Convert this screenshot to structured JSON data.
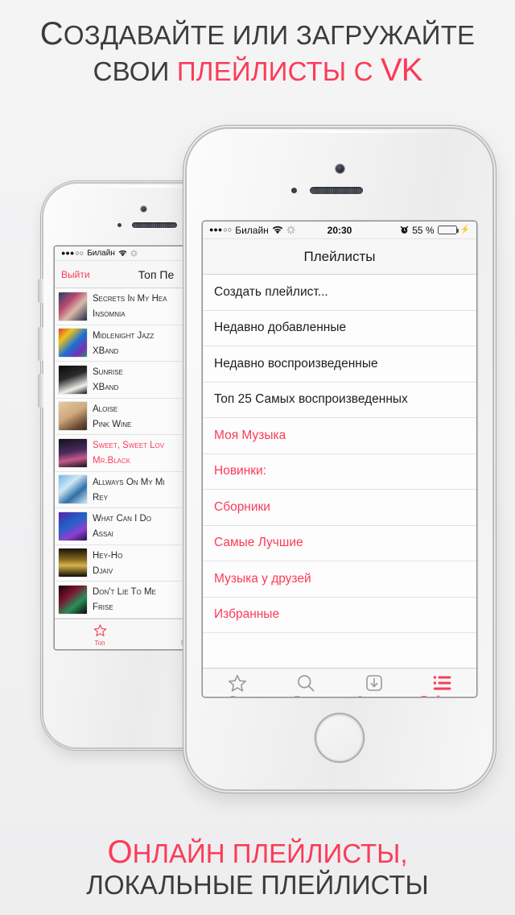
{
  "promo": {
    "headline_line1_lead": "С",
    "headline_line1_rest": "ОЗДАВАЙТЕ ИЛИ ЗАГРУЖАЙТЕ",
    "headline_line2_plain": "СВОИ ",
    "headline_line2_accent": "ПЛЕЙЛИСТЫ С ",
    "headline_line2_brand": "VK",
    "footline_lead": "О",
    "footline_accent_rest": "НЛАЙН ПЛЕЙЛИСТЫ,",
    "footline_line2": "ЛОКАЛЬНЫЕ ПЛЕЙЛИСТЫ",
    "accent_color": "#fb3b58",
    "text_color": "#3c3c3e",
    "background_color": "#f2f2f3"
  },
  "front_phone": {
    "status_bar": {
      "signal_dots_filled": "●●●",
      "signal_dots_empty": "○○",
      "carrier": "Билайн",
      "wifi_icon": "wifi-icon",
      "activity_icon": "spinner-icon",
      "time": "20:30",
      "alarm_icon": "alarm-clock-icon",
      "battery_percent": "55 %",
      "battery_level": 55,
      "battery_color": "#4cd551",
      "charging_icon": "bolt-icon"
    },
    "nav": {
      "title": "Плейлисты"
    },
    "rows": [
      {
        "label": "Создать плейлист...",
        "accent": false
      },
      {
        "label": "Недавно добавленные",
        "accent": false
      },
      {
        "label": "Недавно воспроизведенные",
        "accent": false
      },
      {
        "label": "Топ 25 Самых воспроизведенных",
        "accent": false
      },
      {
        "label": "Моя Музыка",
        "accent": true
      },
      {
        "label": "Новинки:",
        "accent": true
      },
      {
        "label": "Сборники",
        "accent": true
      },
      {
        "label": "Самые Лучшие",
        "accent": true
      },
      {
        "label": "Музыка у друзей",
        "accent": true
      },
      {
        "label": "Избранные",
        "accent": true
      }
    ],
    "tabs": [
      {
        "label": "Топ",
        "icon": "star-icon",
        "active": false
      },
      {
        "label": "Поиск",
        "icon": "search-icon",
        "active": false
      },
      {
        "label": "Загрузки",
        "icon": "download-icon",
        "active": false
      },
      {
        "label": "Плейлисты",
        "icon": "list-icon",
        "active": true
      }
    ]
  },
  "back_phone": {
    "status_bar": {
      "signal_dots_filled": "●●●",
      "signal_dots_empty": "○○",
      "carrier": "Билайн",
      "wifi_icon": "wifi-icon",
      "activity_icon": "spinner-icon"
    },
    "nav": {
      "left_button": "Выйти",
      "title": "Топ Пе"
    },
    "songs": [
      {
        "title": "Secrets in my hea",
        "artist": "Insomnia",
        "playing": false,
        "art": "linear-gradient(135deg,#2a3f6b 0%,#b84a6e 35%,#d9b9a8 60%,#1d2a44 100%)"
      },
      {
        "title": "Midlenight jazz",
        "artist": "xBand",
        "playing": false,
        "art": "linear-gradient(135deg,#e23b2f 0%,#f0c419 25%,#1b6fd4 55%,#7b2fb5 80%,#14a06a 100%)"
      },
      {
        "title": "Sunrise",
        "artist": "xBand",
        "playing": false,
        "art": "linear-gradient(160deg,#0b0b0b 0%,#2b2b2b 40%,#f0efe8 75%,#111111 100%)"
      },
      {
        "title": "Aloise",
        "artist": "Pink wine",
        "playing": false,
        "art": "linear-gradient(150deg,#e3c9a6 0%,#cfa97c 45%,#6a4a33 80%,#3c2a1e 100%)"
      },
      {
        "title": "Sweet, sweet lov",
        "artist": "Mr.Black",
        "playing": true,
        "art": "linear-gradient(170deg,#11131c 0%,#4a2b5e 45%,#c55a8a 70%,#16111c 100%)"
      },
      {
        "title": "Allways on my mi",
        "artist": "Rey",
        "playing": false,
        "art": "linear-gradient(140deg,#6fb7e8 0%,#cfe7f5 35%,#2f6fa8 65%,#d7e9f2 100%)"
      },
      {
        "title": "What can i do",
        "artist": "Assai",
        "playing": false,
        "art": "linear-gradient(150deg,#5b21a8 0%,#1d63c9 40%,#8f3fd0 70%,#241050 100%)"
      },
      {
        "title": "Hey-ho",
        "artist": "Djaiv",
        "playing": false,
        "art": "linear-gradient(180deg,#171309 0%,#8a6a22 40%,#d8b24c 60%,#0f0c06 100%)"
      },
      {
        "title": "Don't lie to me",
        "artist": "Frise",
        "playing": false,
        "art": "linear-gradient(140deg,#14040a 0%,#7a1430 35%,#2b8f5a 65%,#0d0408 100%)"
      }
    ],
    "tabs": [
      {
        "label": "Топ",
        "icon": "star-icon",
        "active": true
      },
      {
        "label": "Поиск",
        "icon": "search-icon",
        "active": false
      }
    ]
  }
}
